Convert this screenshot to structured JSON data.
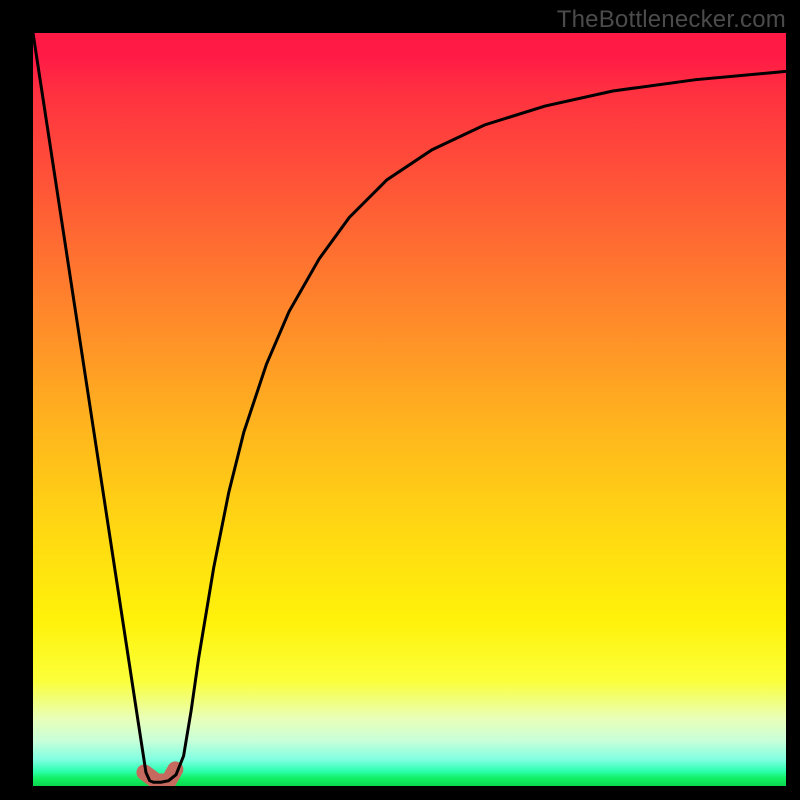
{
  "watermark": "TheBottlenecker.com",
  "chart_data": {
    "type": "line",
    "title": "",
    "xlabel": "",
    "ylabel": "",
    "xlim": [
      0,
      100
    ],
    "ylim": [
      0,
      100
    ],
    "legend_position": "none",
    "grid": false,
    "background_gradient": {
      "direction": "vertical",
      "stops": [
        {
          "pos": 0,
          "color": "#ff1a46"
        },
        {
          "pos": 22,
          "color": "#ff8a2a"
        },
        {
          "pos": 52,
          "color": "#ffd812"
        },
        {
          "pos": 86,
          "color": "#fbff3a"
        },
        {
          "pos": 98,
          "color": "#2dffb0"
        },
        {
          "pos": 100,
          "color": "#0ad74e"
        }
      ]
    },
    "series": [
      {
        "name": "v-curve",
        "type": "line",
        "stroke": "#000000",
        "strokeWidth": 3,
        "x": [
          0.0,
          2.0,
          4.0,
          6.0,
          8.0,
          10.0,
          12.0,
          14.0,
          15.0,
          15.5,
          16.0,
          17.0,
          18.0,
          19.0,
          20.0,
          21.0,
          22.0,
          24.0,
          26.0,
          28.0,
          31.0,
          34.0,
          38.0,
          42.0,
          47.0,
          53.0,
          60.0,
          68.0,
          77.0,
          88.0,
          100.0
        ],
        "y": [
          100.0,
          86.9,
          73.8,
          60.7,
          47.6,
          34.5,
          21.4,
          8.3,
          1.8,
          0.7,
          0.5,
          0.5,
          0.7,
          1.5,
          4.0,
          10.0,
          17.0,
          29.0,
          39.0,
          47.0,
          56.0,
          63.0,
          70.0,
          75.5,
          80.5,
          84.5,
          87.8,
          90.3,
          92.3,
          93.8,
          94.9
        ]
      },
      {
        "name": "bottom-marker",
        "type": "line",
        "stroke": "#c66a5f",
        "strokeWidth": 16,
        "linecap": "round",
        "x": [
          14.8,
          16.4,
          18.0,
          18.9
        ],
        "y": [
          1.8,
          0.6,
          0.6,
          2.2
        ]
      }
    ]
  }
}
